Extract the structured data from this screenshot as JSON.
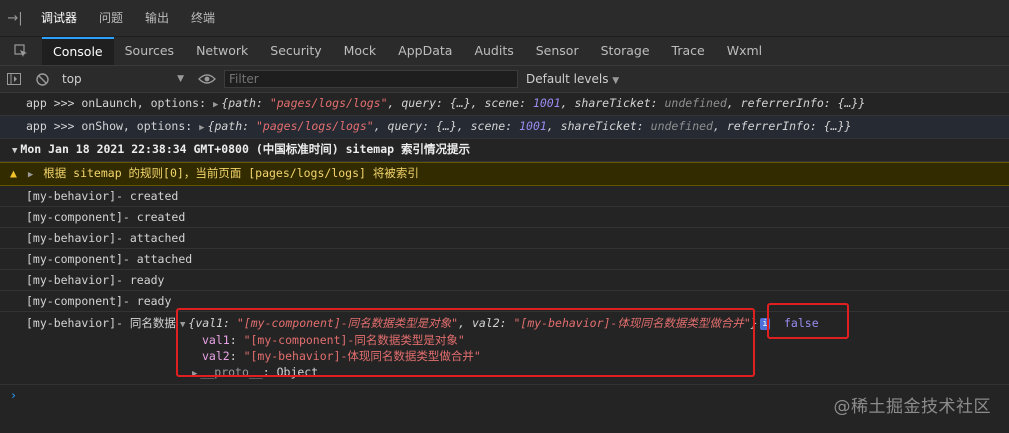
{
  "top_tabs": {
    "items": [
      "调试器",
      "问题",
      "输出",
      "终端"
    ]
  },
  "dev_tabs": {
    "items": [
      "Console",
      "Sources",
      "Network",
      "Security",
      "Mock",
      "AppData",
      "Audits",
      "Sensor",
      "Storage",
      "Trace",
      "Wxml"
    ]
  },
  "toolbar": {
    "context": "top",
    "filter_placeholder": "Filter",
    "levels": "Default levels"
  },
  "logs": {
    "onlaunch": {
      "prefix": "app >>> onLaunch, options: ",
      "brace_open": "{path: ",
      "path": "\"pages/logs/logs\"",
      "q": ", query: {…}, scene: ",
      "scene": "1001",
      "st": ", shareTicket: ",
      "st_val": "undefined",
      "ri": ", referrerInfo: {…}}"
    },
    "onshow": {
      "prefix": "app >>> onShow, options: ",
      "brace_open": "{path: ",
      "path": "\"pages/logs/logs\"",
      "q": ", query: {…}, scene: ",
      "scene": "1001",
      "st": ", shareTicket: ",
      "st_val": "undefined",
      "ri": ", referrerInfo: {…}}"
    },
    "group_header": "Mon Jan 18 2021 22:38:34 GMT+0800 (中国标准时间) sitemap 索引情况提示",
    "warning": "根据 sitemap 的规则[0]，当前页面 [pages/logs/logs] 将被索引",
    "lines": [
      "[my-behavior]- created",
      "[my-component]- created",
      "[my-behavior]- attached",
      "[my-component]- attached",
      "[my-behavior]- ready",
      "[my-component]- ready"
    ],
    "merge": {
      "label": "[my-behavior]- 同名数据",
      "summary_open": "{val1: ",
      "val1_str": "\"[my-component]-同名数据类型是对象\"",
      "mid": ", val2: ",
      "val2_str": "\"[my-behavior]-体现同名数据类型做合并\"",
      "summary_close": "}",
      "badge": "i",
      "second_value": "false",
      "val1_key": "val1",
      "val1_value": "\"[my-component]-同名数据类型是对象\"",
      "val2_key": "val2",
      "val2_value": "\"[my-behavior]-体现同名数据类型做合并\"",
      "proto_key": "__proto__",
      "proto_value": "Object"
    }
  },
  "watermark": "@稀土掘金技术社区",
  "colors": {
    "accent": "#2aa0ff",
    "highlight_box": "#e02020",
    "string": "#e36e6e",
    "number": "#9a8cf1",
    "warning_bg": "#332b00"
  }
}
